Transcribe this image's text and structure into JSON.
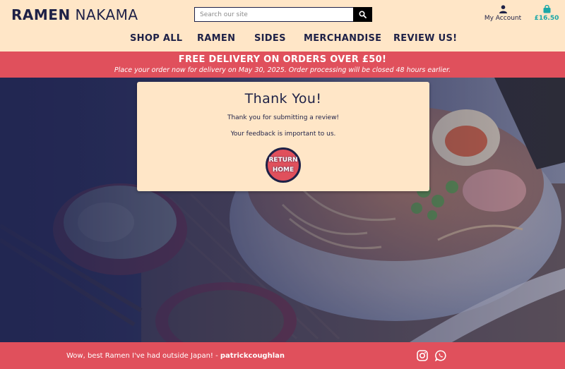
{
  "brand": {
    "logo_bold": "RAMEN",
    "logo_light": "NAKAMA"
  },
  "search": {
    "placeholder": "Search our site",
    "button_icon": "search-icon"
  },
  "account": {
    "label": "My Account",
    "icon": "user-icon"
  },
  "cart": {
    "total": "£16.50",
    "icon": "shopping-bag-icon"
  },
  "nav": {
    "items": [
      "SHOP ALL",
      "RAMEN",
      "SIDES",
      "MERCHANDISE",
      "REVIEW US!"
    ]
  },
  "promo": {
    "headline": "FREE DELIVERY ON ORDERS OVER £50!",
    "subline": "Place your order now for delivery on May 30, 2025. Order processing will be closed 48 hours earlier."
  },
  "modal": {
    "title": "Thank You!",
    "line1": "Thank you for submitting a review!",
    "line2": "Your feedback is important to us.",
    "button_line1": "RETURN",
    "button_line2": "HOME"
  },
  "footer": {
    "quote": "Wow, best Ramen I've had outside Japan! - ",
    "author": "patrickcoughlan",
    "social_icons": [
      "instagram-icon",
      "whatsapp-icon"
    ]
  },
  "colors": {
    "navy": "#1e2147",
    "cream": "#ffe6c7",
    "coral": "#e0505c",
    "teal": "#1aa7a7"
  }
}
